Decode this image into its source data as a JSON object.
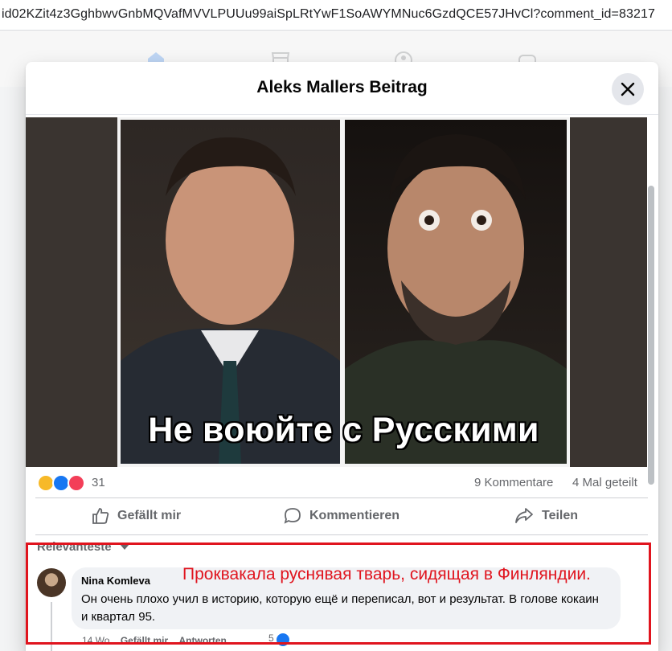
{
  "browser": {
    "url": "id02KZit4z3GghbwvGnbMQVafMVVLPUUu99aiSpLRtYwF1SoAWYMNuc6GzdQCE57JHvCl?comment_id=83217"
  },
  "nav": {
    "icons": [
      "home-icon",
      "marketplace-icon",
      "groups-icon",
      "gaming-icon"
    ]
  },
  "modal": {
    "title": "Aleks Mallers Beitrag"
  },
  "post": {
    "image_caption": "Не воюйте с Русскими",
    "reaction_count": "31",
    "reaction_types": [
      "haha",
      "like",
      "love"
    ],
    "comments_count": "9 Kommentare",
    "shares_count": "4 Mal geteilt"
  },
  "actions": {
    "like": "Gefällt mir",
    "comment": "Kommentieren",
    "share": "Teilen"
  },
  "comments": {
    "sort_label": "Relevanteste",
    "items": [
      {
        "author": "Nina Komleva",
        "text": "Он очень плохо учил в историю, которую ещё и переписал, вот и результат. В голове кокаин и квартал 95.",
        "time": "14 Wo",
        "like": "Gefällt mir",
        "reply": "Antworten",
        "reactions": "5"
      }
    ]
  },
  "annotation": {
    "text": "Проквакала руснявая тварь, сидящая в Финляндии.",
    "color": "#e0141e"
  },
  "colors": {
    "brand": "#1877f2",
    "secondary_text": "#65676b"
  }
}
